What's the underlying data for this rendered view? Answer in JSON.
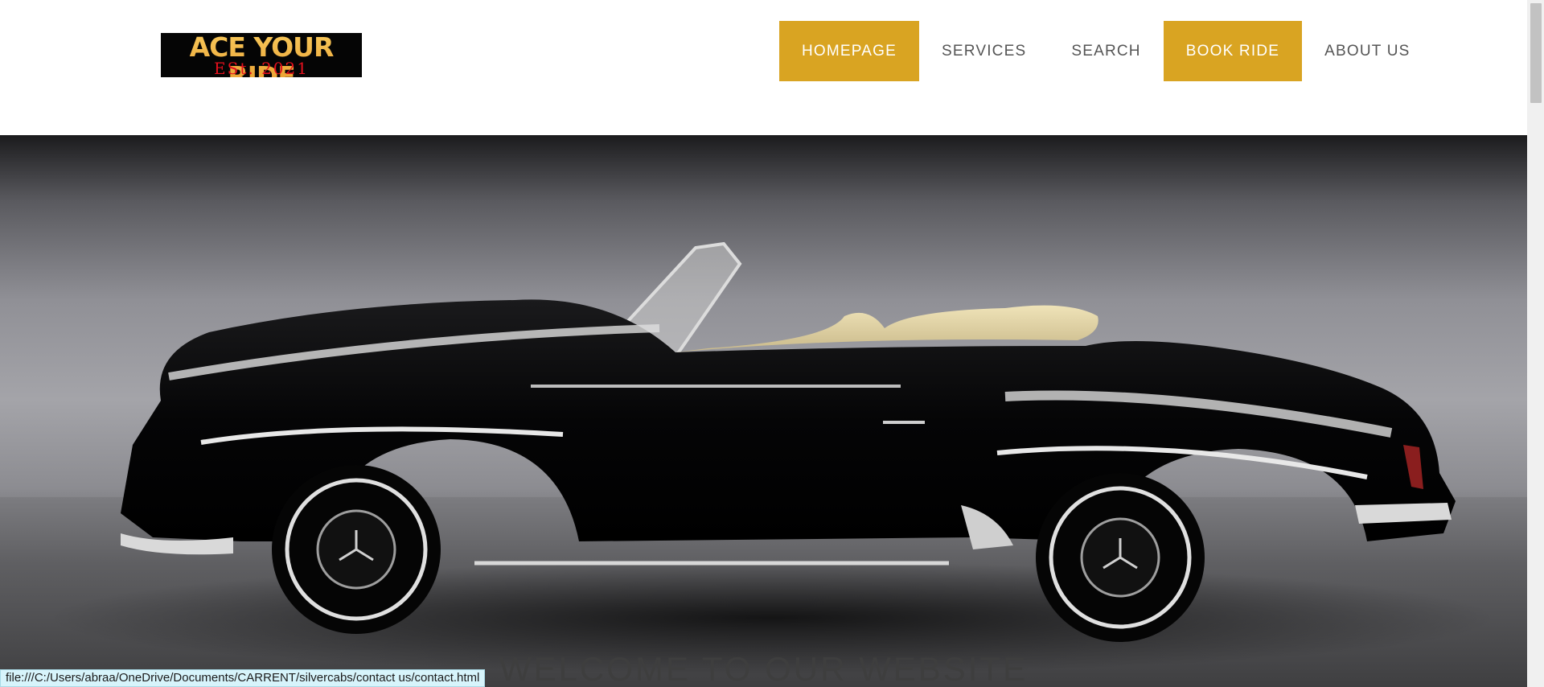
{
  "logo": {
    "main_text": "ACE YOUR RIDE",
    "sub_text": "ESt. 2021"
  },
  "nav": {
    "items": [
      {
        "label": "HOMEPAGE",
        "active": true
      },
      {
        "label": "SERVICES",
        "active": false
      },
      {
        "label": "SEARCH",
        "active": false
      },
      {
        "label": "BOOK RIDE",
        "active": true
      },
      {
        "label": "ABOUT US",
        "active": false
      }
    ]
  },
  "hero": {
    "heading": "WELCOME TO OUR WEBSITE"
  },
  "status_bar": {
    "url": "file:///C:/Users/abraa/OneDrive/Documents/CARRENT/silvercabs/contact us/contact.html"
  },
  "colors": {
    "accent": "#d9a422",
    "logo_gold": "#f2b443",
    "logo_red": "#e5101d",
    "nav_text": "#555555"
  }
}
